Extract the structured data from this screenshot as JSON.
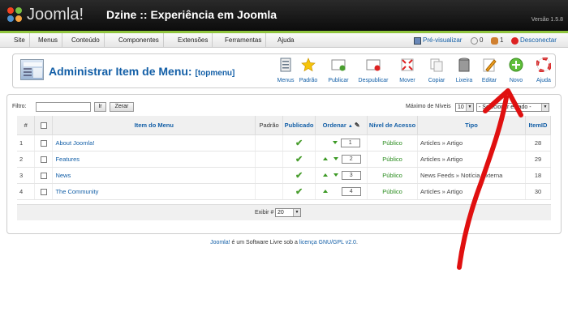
{
  "header": {
    "logo_text": "Joomla!",
    "site_title": "Dzine :: Experiência em Joomla",
    "version": "Versão 1.5.8"
  },
  "menubar": {
    "items": [
      "Site",
      "Menus",
      "Conteúdo",
      "Componentes",
      "Extensões",
      "Ferramentas",
      "Ajuda"
    ],
    "preview_label": "Pré-visualizar",
    "messages_count": "0",
    "users_count": "1",
    "logout_label": "Desconectar"
  },
  "toolbar": {
    "title": "Administrar Item de Menu:",
    "menu_name": "[topmenu]",
    "buttons": [
      "Menus",
      "Padrão",
      "Publicar",
      "Despublicar",
      "Mover",
      "Copiar",
      "Lixeira",
      "Editar",
      "Novo",
      "Ajuda"
    ]
  },
  "filter": {
    "label": "Filtro:",
    "value": "",
    "go_label": "Ir",
    "reset_label": "Zerar",
    "levels_label": "Máximo de Níveis",
    "levels_value": "10",
    "state_value": "- Selecionar estado -"
  },
  "table": {
    "headers": {
      "num": "#",
      "item": "Item do Menu",
      "default": "Padrão",
      "published": "Publicado",
      "order": "Ordenar",
      "access": "Nível de Acesso",
      "type": "Tipo",
      "id": "ItemID"
    },
    "rows": [
      {
        "num": "1",
        "title": "About Joomla!",
        "published": "✔",
        "order": "1",
        "access": "Público",
        "type": "Articles » Artigo",
        "id": "28"
      },
      {
        "num": "2",
        "title": "Features",
        "published": "✔",
        "order": "2",
        "access": "Público",
        "type": "Articles » Artigo",
        "id": "29"
      },
      {
        "num": "3",
        "title": "News",
        "published": "✔",
        "order": "3",
        "access": "Público",
        "type": "News Feeds » Notícia Externa",
        "id": "18"
      },
      {
        "num": "4",
        "title": "The Community",
        "published": "✔",
        "order": "4",
        "access": "Público",
        "type": "Articles » Artigo",
        "id": "30"
      }
    ]
  },
  "pager": {
    "label": "Exibir #",
    "value": "20"
  },
  "footer": {
    "link1": "Joomla!",
    "text": " é um Software Livre sob a ",
    "link2": "licença GNU/GPL v2.0",
    "end": "."
  },
  "colors": {
    "accent_blue": "#135fa7",
    "green_bar": "#8fc43e",
    "annotation_red": "#e01010"
  }
}
